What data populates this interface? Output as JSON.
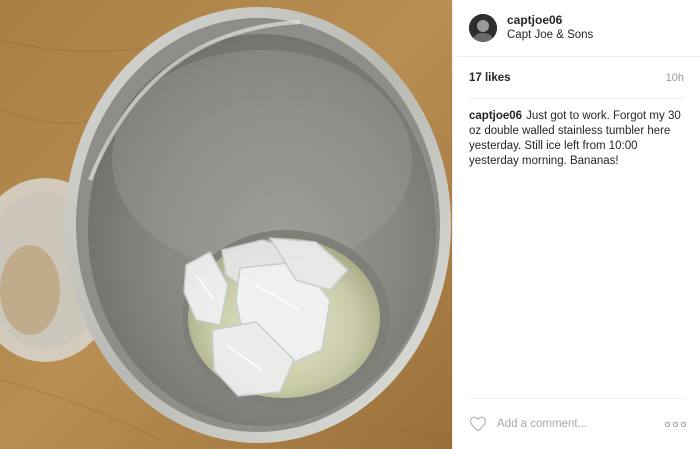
{
  "post": {
    "image": {
      "description_icon": "tumbler-photo"
    },
    "author": {
      "username": "captjoe06",
      "location": "Capt Joe & Sons",
      "avatar_icon": "profile-avatar"
    },
    "likes": "17 likes",
    "time_ago": "10h",
    "caption": {
      "username": "captjoe06",
      "text": "Just got to work. Forgot my 30 oz double walled stainless tumbler here yesterday. Still ice left from 10:00 yesterday morning. Bananas!"
    },
    "comment": {
      "placeholder": "Add a comment...",
      "like_icon": "heart-icon",
      "more_icon": "more-options-icon"
    }
  }
}
